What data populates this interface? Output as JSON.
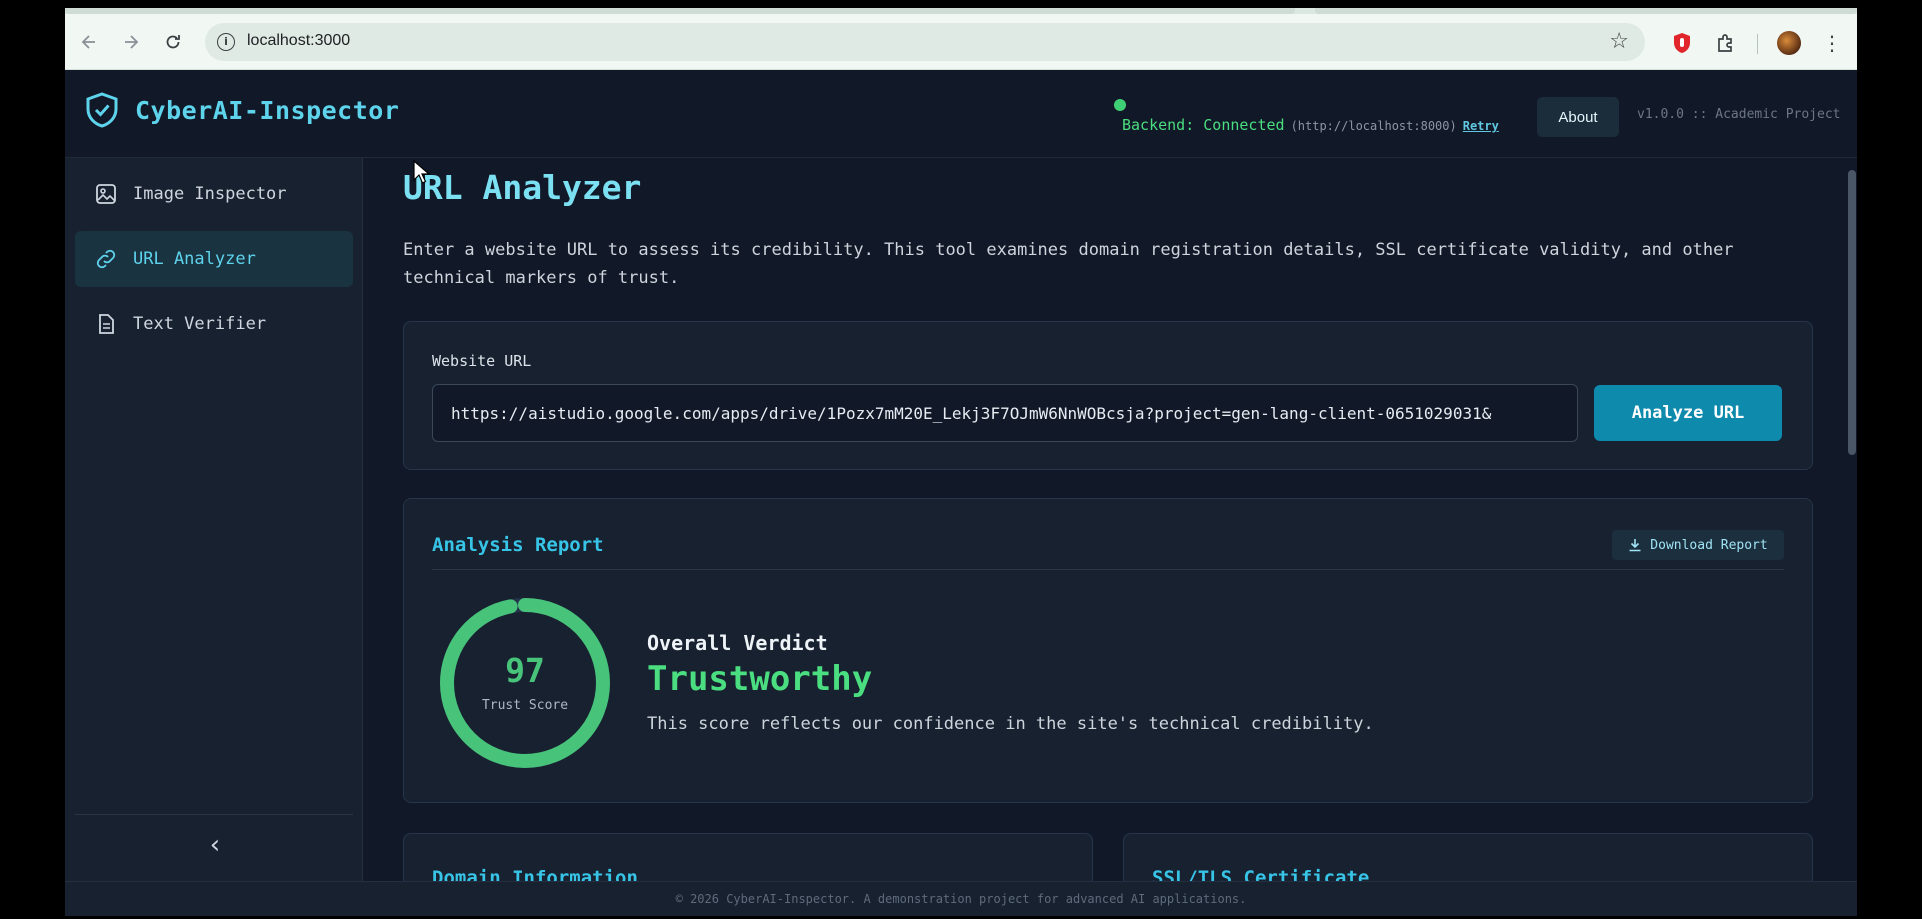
{
  "browser": {
    "url": "localhost:3000",
    "back_icon": "arrow-left-icon",
    "forward_icon": "arrow-right-icon",
    "reload_icon": "reload-icon"
  },
  "header": {
    "app_title": "CyberAI-Inspector",
    "status_text": "Backend: Connected",
    "backend_url": "(http://localhost:8000)",
    "retry_label": "Retry",
    "about_label": "About",
    "version": "v1.0.0 :: Academic Project",
    "accent_color": "#5ed3ec",
    "status_color": "#4ade80"
  },
  "sidebar": {
    "items": [
      {
        "label": "Image Inspector",
        "icon": "image-icon",
        "active": false
      },
      {
        "label": "URL Analyzer",
        "icon": "link-icon",
        "active": true
      },
      {
        "label": "Text Verifier",
        "icon": "document-icon",
        "active": false
      }
    ],
    "collapse_icon": "chevron-left-icon"
  },
  "main": {
    "title": "URL Analyzer",
    "description": "Enter a website URL to assess its credibility. This tool examines domain registration details, SSL certificate validity, and other technical markers of trust.",
    "url_form": {
      "label": "Website URL",
      "value": "https://aistudio.google.com/apps/drive/1Pozx7mM20E_Lekj3F7OJmW6NnWOBcsja?project=gen-lang-client-0651029031&",
      "button_label": "Analyze URL"
    },
    "report": {
      "title": "Analysis Report",
      "download_label": "Download Report",
      "score": "97",
      "score_fraction": 0.97,
      "score_label": "Trust Score",
      "verdict_label": "Overall Verdict",
      "verdict": "Trustworthy",
      "verdict_description": "This score reflects our confidence in the site's technical credibility."
    },
    "sections": {
      "domain_title": "Domain Information",
      "ssl_title": "SSL/TLS Certificate"
    }
  },
  "footer": {
    "text": "© 2026 CyberAI-Inspector. A demonstration project for advanced AI applications."
  }
}
